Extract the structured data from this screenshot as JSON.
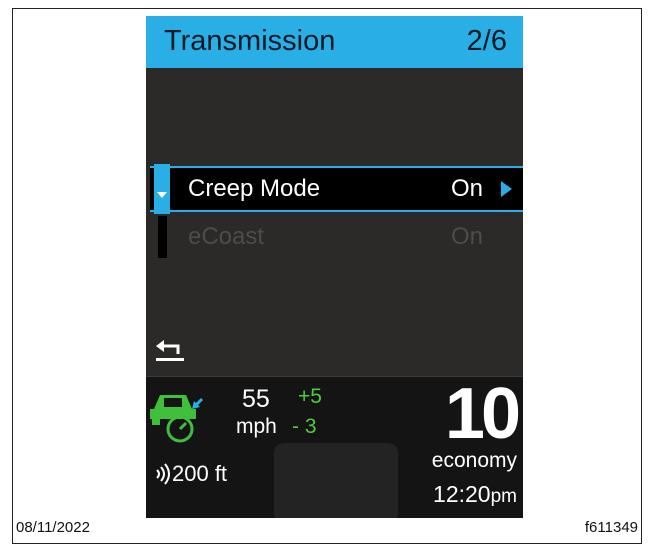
{
  "header": {
    "title": "Transmission",
    "page": "2/6"
  },
  "menu": {
    "items": [
      {
        "label": "Creep Mode",
        "value": "On",
        "selected": true
      },
      {
        "label": "eCoast",
        "value": "On",
        "selected": false
      }
    ]
  },
  "back": {
    "icon": "back-arrow-icon"
  },
  "status": {
    "speed": "55",
    "speed_unit": "mph",
    "offset_plus": "+5",
    "offset_minus": "- 3",
    "distance": "200 ft",
    "gear_number": "10",
    "mode": "economy",
    "time": "12:20",
    "time_suffix": "pm"
  },
  "footer": {
    "date": "08/11/2022",
    "figure_id": "f611349"
  },
  "colors": {
    "accent": "#29aee6",
    "green": "#4ccd3c",
    "background": "#2b2a29"
  }
}
